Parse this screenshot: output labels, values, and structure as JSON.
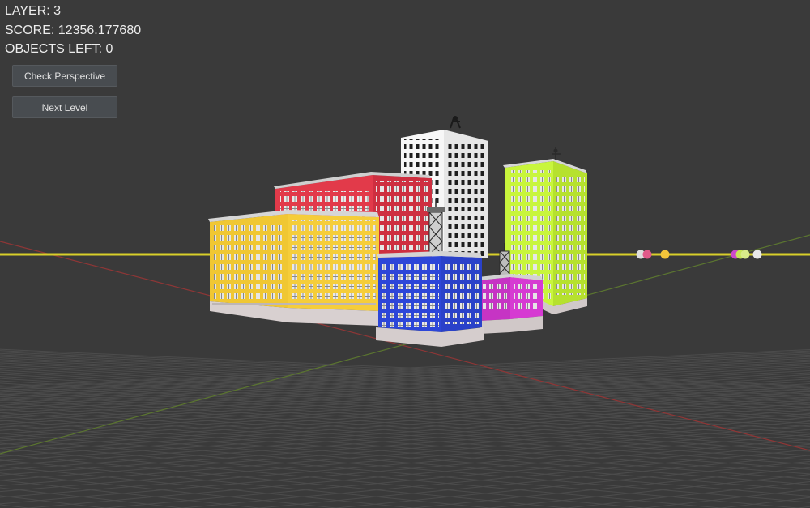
{
  "hud": {
    "layer_text": "LAYER: 3",
    "score_text": "SCORE: 12356.177680",
    "objects_left_text": "OBJECTS LEFT: 0"
  },
  "buttons": {
    "check_perspective": "Check Perspective",
    "next_level": "Next Level"
  },
  "scene": {
    "background": "#3a3a3a",
    "horizon_line_color": "#d8cf2a",
    "x_axis_color": "#9a3a3a",
    "z_axis_color": "#5f7a2e",
    "buildings": [
      {
        "name": "white-tower",
        "color": "#f4f4f4"
      },
      {
        "name": "red-building",
        "color": "#e23a4a"
      },
      {
        "name": "green-tower",
        "color": "#c8f53c"
      },
      {
        "name": "yellow-building",
        "color": "#f5cd3a"
      },
      {
        "name": "blue-building",
        "color": "#2d46d8"
      },
      {
        "name": "magenta-building",
        "color": "#d63ad2"
      }
    ],
    "markers": [
      {
        "name": "white-marker",
        "color": "#dedede"
      },
      {
        "name": "pink-marker",
        "color": "#e25a8a"
      },
      {
        "name": "yellow-marker",
        "color": "#f3c43a"
      },
      {
        "name": "magenta-marker",
        "color": "#cc48cc"
      },
      {
        "name": "green-marker",
        "color": "#c8e65a"
      },
      {
        "name": "lightgreen-marker",
        "color": "#d9ec8a"
      },
      {
        "name": "white-marker-2",
        "color": "#e8e8e8"
      }
    ]
  }
}
